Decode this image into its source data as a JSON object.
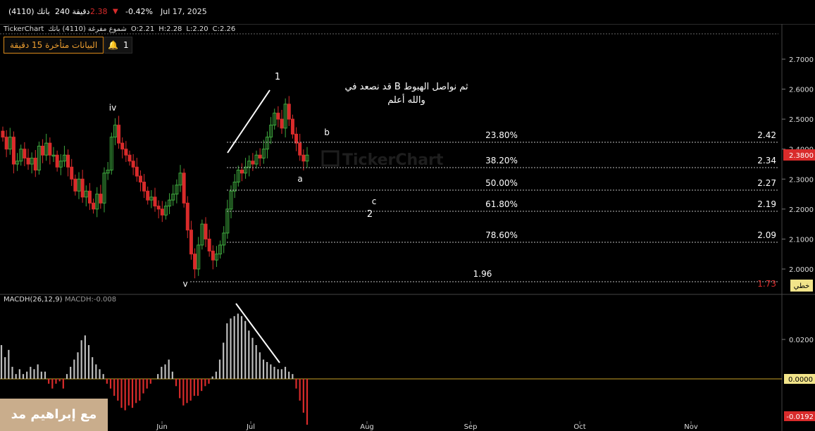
{
  "header": {
    "date": "Jul 17, 2025",
    "change_pct": "-0.42%",
    "price": "2.38",
    "timeframe": "240 دقيقة",
    "symbol": "(4110) باتك"
  },
  "ohlc": {
    "source": "TickerChart",
    "name": "شموع مفرغة (4110) باتك",
    "open": "O:2.21",
    "high": "H:2.28",
    "low": "L:2.20",
    "close": "C:2.26"
  },
  "delay_notice": "البيانات متأخرة 15 دقيقة",
  "alerts_count": "1",
  "watermark_text": "TickerChart",
  "author_tag": "مع إبراهيم مد",
  "annotation": {
    "line1": "قد نصعد في B ثم نواصل الهبوط",
    "line2": "والله أعلم"
  },
  "wave_labels": [
    "1",
    "2",
    "iv",
    "v",
    "a",
    "b",
    "c"
  ],
  "indicator_label": {
    "name": "MACDH(26,12,9)",
    "value": "MACDH:-0.008"
  },
  "axis": {
    "x_ticks": [
      "Jun",
      "Jul",
      "Aug",
      "Sep",
      "Oct",
      "Nov"
    ],
    "price_ticks": [
      "2.7000",
      "2.6000",
      "2.5000",
      "2.4000",
      "2.3000",
      "2.2000",
      "2.1000",
      "2.0000"
    ],
    "current_price_tag": "2.3800",
    "line_tag": "خطي",
    "macd_ticks": [
      "0.0200",
      "0.0000",
      "-0.0192"
    ]
  },
  "colors": {
    "up": "#3ea83e",
    "down": "#d92b2b",
    "fib_line": "#bdbdbd",
    "price_tag_bg": "#d92b2b",
    "line_tag_bg": "#f2e48a",
    "zero_line": "#c9a227",
    "hist_pos": "#bdbdbd",
    "hist_neg": "#d92b2b"
  },
  "chart_data": {
    "type": "candlestick",
    "price_ylim": [
      1.96,
      2.76
    ],
    "fib_levels": [
      {
        "pct": "23.80%",
        "price": "2.42"
      },
      {
        "pct": "38.20%",
        "price": "2.34"
      },
      {
        "pct": "50.00%",
        "price": "2.27"
      },
      {
        "pct": "61.80%",
        "price": "2.19"
      },
      {
        "pct": "78.60%",
        "price": "2.09"
      }
    ],
    "fib_low": {
      "label": "1.96",
      "price": "1.73"
    },
    "closes": [
      2.44,
      2.4,
      2.44,
      2.35,
      2.36,
      2.4,
      2.37,
      2.35,
      2.37,
      2.33,
      2.41,
      2.38,
      2.42,
      2.38,
      2.38,
      2.34,
      2.36,
      2.38,
      2.34,
      2.3,
      2.26,
      2.3,
      2.24,
      2.26,
      2.22,
      2.2,
      2.25,
      2.22,
      2.32,
      2.33,
      2.44,
      2.48,
      2.42,
      2.4,
      2.38,
      2.36,
      2.34,
      2.31,
      2.29,
      2.26,
      2.23,
      2.24,
      2.21,
      2.2,
      2.18,
      2.21,
      2.23,
      2.25,
      2.28,
      2.32,
      2.22,
      2.13,
      2.05,
      2.0,
      2.08,
      2.15,
      2.1,
      2.06,
      2.03,
      2.05,
      2.08,
      2.12,
      2.2,
      2.26,
      2.29,
      2.33,
      2.32,
      2.34,
      2.36,
      2.35,
      2.38,
      2.37,
      2.4,
      2.44,
      2.48,
      2.52,
      2.5,
      2.47,
      2.55,
      2.5,
      2.45,
      2.42,
      2.38,
      2.36,
      2.38
    ],
    "macdh": [
      0.014,
      0.009,
      0.012,
      0.005,
      0.002,
      0.004,
      0.002,
      0.003,
      0.005,
      0.004,
      0.006,
      0.003,
      0.003,
      -0.002,
      -0.004,
      -0.002,
      -0.001,
      -0.004,
      0.002,
      0.005,
      0.008,
      0.011,
      0.016,
      0.018,
      0.014,
      0.009,
      0.006,
      0.004,
      0.002,
      -0.002,
      -0.004,
      -0.007,
      -0.009,
      -0.012,
      -0.013,
      -0.011,
      -0.012,
      -0.01,
      -0.009,
      -0.006,
      -0.004,
      -0.002,
      0.0,
      0.002,
      0.005,
      0.006,
      0.008,
      0.003,
      -0.003,
      -0.008,
      -0.011,
      -0.01,
      -0.009,
      -0.007,
      -0.007,
      -0.005,
      -0.003,
      -0.002,
      0.001,
      0.003,
      0.008,
      0.015,
      0.023,
      0.025,
      0.026,
      0.027,
      0.026,
      0.024,
      0.02,
      0.017,
      0.014,
      0.011,
      0.008,
      0.007,
      0.006,
      0.005,
      0.004,
      0.004,
      0.005,
      0.003,
      0.002,
      -0.004,
      -0.009,
      -0.014,
      -0.019
    ]
  }
}
